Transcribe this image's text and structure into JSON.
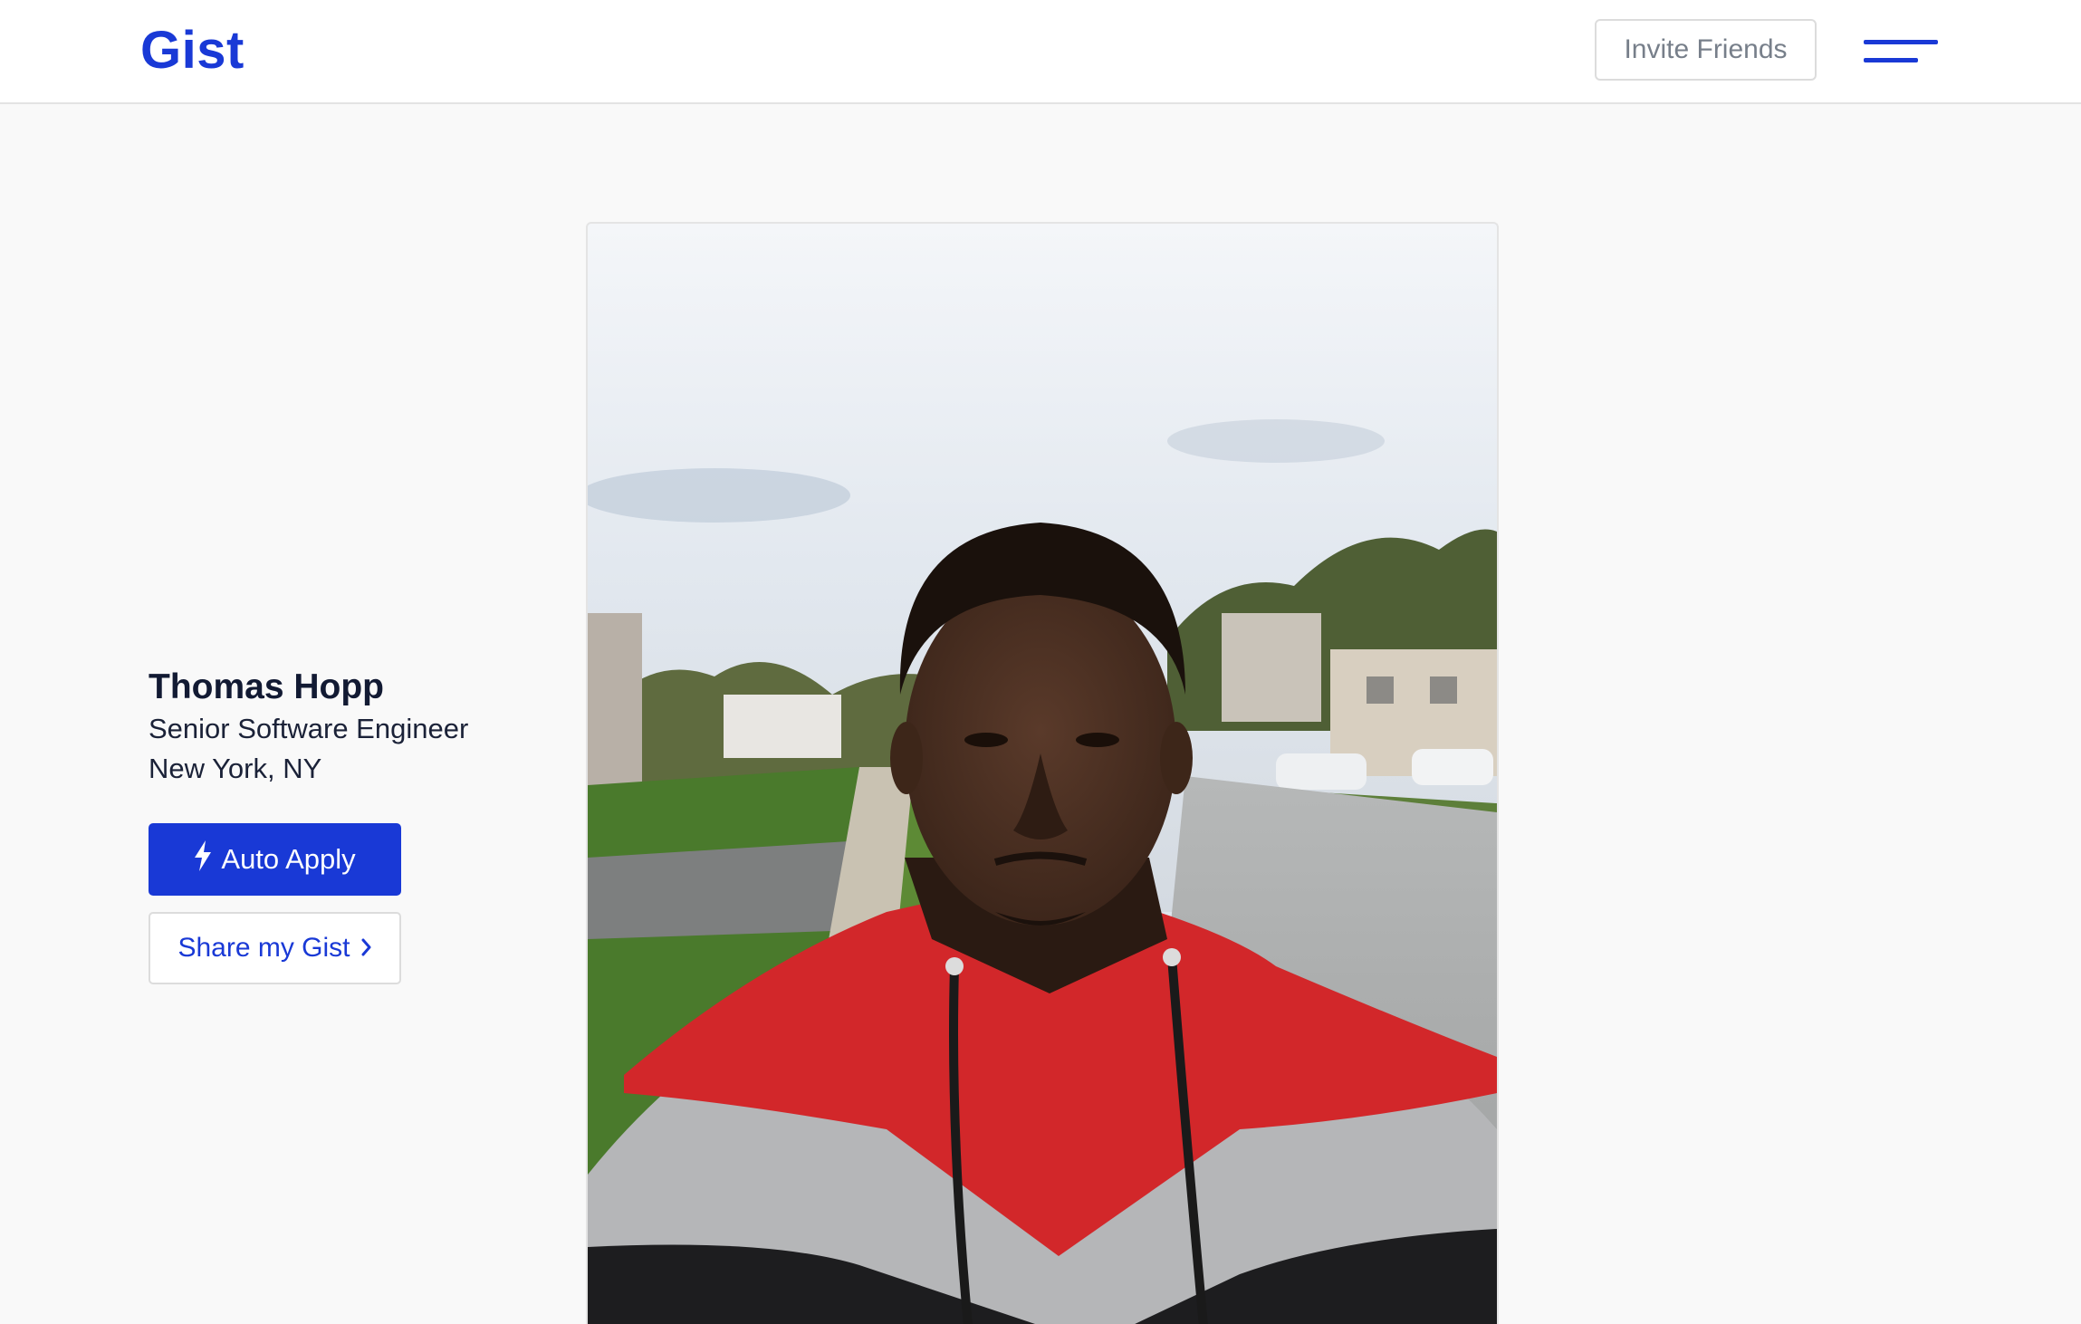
{
  "header": {
    "logo": "Gist",
    "invite_label": "Invite Friends",
    "menu_icon": "hamburger-menu-icon"
  },
  "profile": {
    "name": "Thomas Hopp",
    "title": "Senior Software Engineer",
    "location": "New York, NY",
    "auto_apply_label": "Auto Apply",
    "auto_apply_icon": "lightning-bolt-icon",
    "share_label": "Share my Gist",
    "share_icon": "chevron-right-icon"
  },
  "colors": {
    "brand": "#1939d6",
    "background": "#f9f9f9",
    "text_dark": "#121a33"
  }
}
